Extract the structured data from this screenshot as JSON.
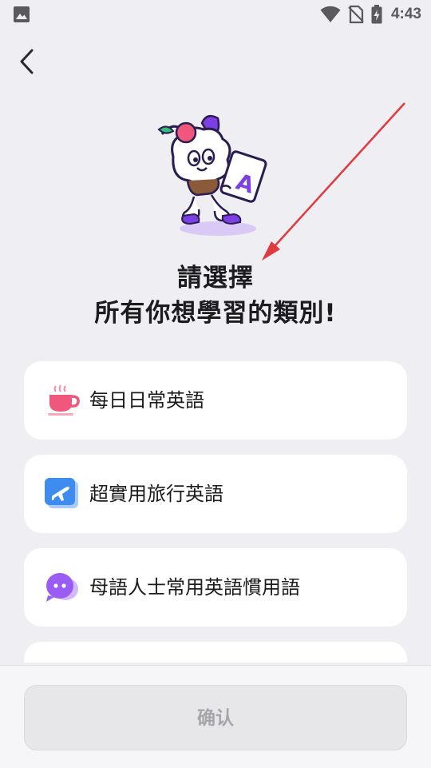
{
  "status_bar": {
    "time": "4:43",
    "icons": [
      "gallery-icon",
      "wifi-icon",
      "no-sim-icon",
      "battery-charging-icon"
    ]
  },
  "nav": {
    "back_icon": "chevron-left-icon"
  },
  "heading": {
    "line1": "請選擇",
    "line2": "所有你想學習的類別!"
  },
  "options": [
    {
      "label": "每日日常英語",
      "icon": "coffee-cup-icon",
      "color": "#f0577c"
    },
    {
      "label": "超實用旅行英語",
      "icon": "airplane-ticket-icon",
      "color": "#3f8cf0"
    },
    {
      "label": "母語人士常用英語慣用語",
      "icon": "chat-bubble-icon",
      "color": "#9a5cf2"
    }
  ],
  "footer": {
    "confirm_label": "确认"
  },
  "colors": {
    "background": "#eeeef3",
    "card": "#ffffff",
    "accent_purple": "#7b3fe4",
    "annotation_arrow": "#e0393e",
    "disabled_button": "#e7e7ea"
  }
}
